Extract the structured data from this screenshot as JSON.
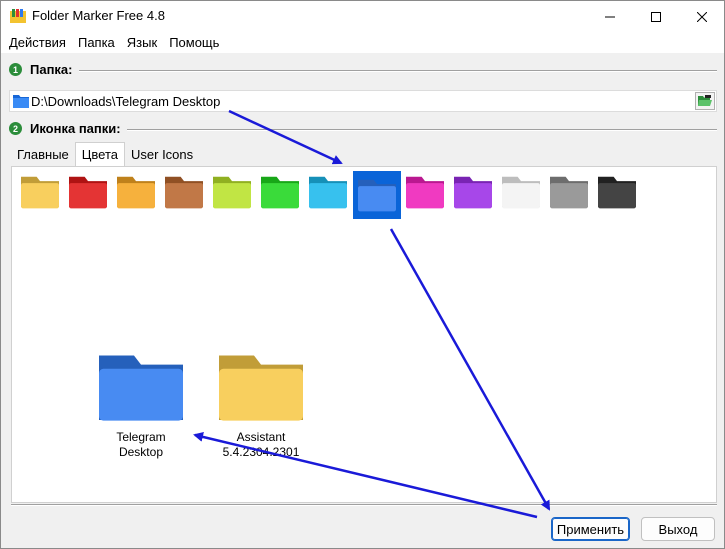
{
  "window": {
    "title": "Folder Marker Free 4.8"
  },
  "menu": {
    "items": [
      "Действия",
      "Папка",
      "Язык",
      "Помощь"
    ]
  },
  "section1": {
    "number": "1",
    "label": "Папка:"
  },
  "path": {
    "value": "D:\\Downloads\\Telegram Desktop"
  },
  "section2": {
    "number": "2",
    "label": "Иконка папки:"
  },
  "tabs": [
    {
      "label": "Главные"
    },
    {
      "label": "Цвета"
    },
    {
      "label": "User Icons"
    }
  ],
  "active_tab": "Цвета",
  "swatches": [
    {
      "name": "yellow",
      "color": "#f7c948"
    },
    {
      "name": "red",
      "color": "#e01818"
    },
    {
      "name": "orange",
      "color": "#f5a623"
    },
    {
      "name": "brown",
      "color": "#b8662e"
    },
    {
      "name": "lime",
      "color": "#b8e22a"
    },
    {
      "name": "green",
      "color": "#1fd61f"
    },
    {
      "name": "cyan",
      "color": "#1cb8ec"
    },
    {
      "name": "blue",
      "color": "#2f7bf0",
      "selected": true
    },
    {
      "name": "pink",
      "color": "#ee1fb8"
    },
    {
      "name": "purple",
      "color": "#9b2ee6"
    },
    {
      "name": "white",
      "color": "#f2f2f2"
    },
    {
      "name": "gray",
      "color": "#8c8c8c"
    },
    {
      "name": "black",
      "color": "#2a2a2a"
    }
  ],
  "preview": [
    {
      "line1": "Telegram",
      "line2": "Desktop",
      "color": "#2f7bf0"
    },
    {
      "line1": "Assistant",
      "line2": "5.4.2304.2301",
      "color": "#f7c948"
    }
  ],
  "buttons": {
    "apply": "Применить",
    "exit": "Выход"
  },
  "colors": {
    "accent": "#1a66c8",
    "arrow": "#1a1ad8"
  }
}
